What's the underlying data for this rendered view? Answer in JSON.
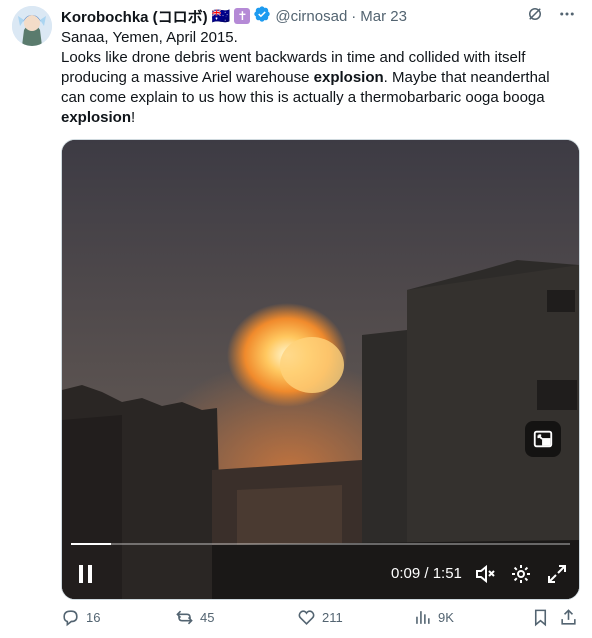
{
  "tweet": {
    "author_name": "Korobochka (コロボ)",
    "flags": [
      "🇦🇺",
      "✝"
    ],
    "handle": "@cirnosad",
    "separator": "·",
    "date": "Mar 23",
    "text_line1": "Sanaa, Yemen, April 2015.",
    "text_segments": [
      "Looks like drone debris went backwards in time and collided with itself producing a massive Ariel warehouse ",
      "explosion",
      ". Maybe that neanderthal can come explain to us how this is actually a thermobarbaric ooga booga ",
      "explosion",
      "!"
    ]
  },
  "video": {
    "current_time": "0:09",
    "duration": "1:51",
    "time_display": "0:09 / 1:51",
    "progress_fraction": 0.08
  },
  "actions": {
    "replies": "16",
    "reposts": "45",
    "likes": "211",
    "views": "9K"
  },
  "icons": {
    "grok": "grok-icon",
    "more": "more-icon",
    "verified": "verified-badge-icon",
    "pip": "picture-in-picture-icon",
    "pause": "pause-icon",
    "mute": "mute-icon",
    "settings": "settings-icon",
    "fullscreen": "fullscreen-icon",
    "reply": "reply-icon",
    "repost": "repost-icon",
    "like": "like-icon",
    "views": "views-icon",
    "bookmark": "bookmark-icon",
    "share": "share-icon"
  },
  "colors": {
    "verified_blue": "#1d9bf0",
    "muted_text": "#536471",
    "text": "#0f1419"
  }
}
